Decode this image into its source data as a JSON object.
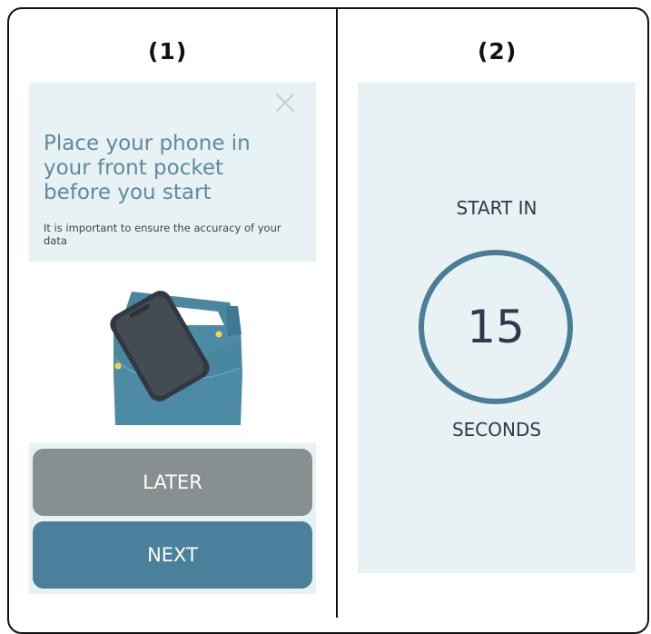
{
  "panels": {
    "left_label": "(1)",
    "right_label": "(2)"
  },
  "screen1": {
    "title": "Place your phone in your front pocket before you start",
    "subtitle": "It is important to ensure the accuracy of your data",
    "close_icon": "close-icon",
    "illustration": "phone-in-pocket-illustration",
    "later_label": "LATER",
    "next_label": "NEXT"
  },
  "screen2": {
    "start_label": "START IN",
    "countdown": "15",
    "unit_label": "SECONDS"
  },
  "colors": {
    "card_background": "#e8f1f3",
    "title_text": "#5b8c9f",
    "later_button": "#888f91",
    "next_button": "#4a8099",
    "ring": "#4a7d96",
    "dark_text": "#2d3a4e"
  }
}
